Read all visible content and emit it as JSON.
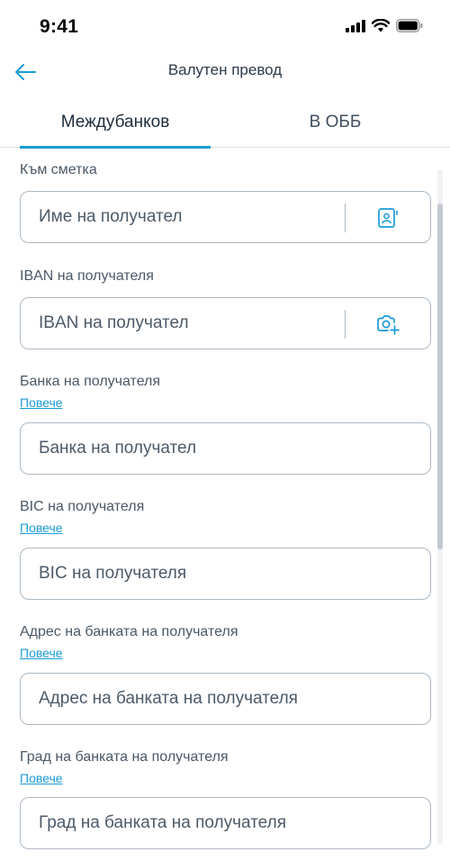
{
  "status_bar": {
    "time": "9:41"
  },
  "header": {
    "title": "Валутен превод"
  },
  "tabs": [
    {
      "label": "Междубанков",
      "active": true
    },
    {
      "label": "В ОББ",
      "active": false
    }
  ],
  "form": {
    "to_account": {
      "label": "Към сметка",
      "placeholder": "Име на получател",
      "icon": "contact-book-icon"
    },
    "iban": {
      "label": "IBAN на получателя",
      "placeholder": "IBAN на получател",
      "icon": "camera-scan-icon"
    },
    "bank": {
      "label": "Банка на получателя",
      "more": "Повече",
      "placeholder": "Банка на получател"
    },
    "bic": {
      "label": "BIC на получателя",
      "more": "Повече",
      "placeholder": "BIC на получателя"
    },
    "bank_address": {
      "label": "Адрес на банката на получателя",
      "more": "Повече",
      "placeholder": "Адрес на банката на получателя"
    },
    "bank_city": {
      "label": "Град на банката на получателя",
      "more": "Повече",
      "placeholder": "Град на банката на получателя"
    }
  },
  "colors": {
    "accent": "#1a9bd7",
    "border": "#aeb9c3",
    "text": "#2b3a4a"
  }
}
